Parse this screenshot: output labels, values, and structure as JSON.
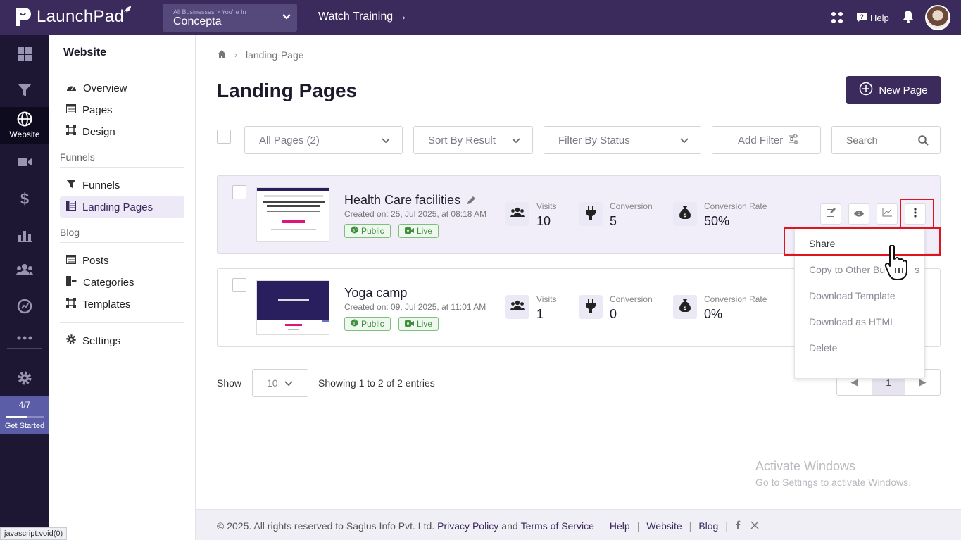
{
  "topbar": {
    "logo_text": "LaunchPad",
    "business_caption": "All Businesses > You're In",
    "business_name": "Concepta",
    "watch_training": "Watch Training →",
    "help_label": "Help"
  },
  "rail": {
    "active_label": "Website",
    "get_started_count": "4/7",
    "get_started_progress": 0.57,
    "get_started_label": "Get Started"
  },
  "sidebar": {
    "title": "Website",
    "items_website": [
      "Overview",
      "Pages",
      "Design"
    ],
    "section_funnels": "Funnels",
    "items_funnels": [
      "Funnels",
      "Landing Pages"
    ],
    "section_blog": "Blog",
    "items_blog": [
      "Posts",
      "Categories",
      "Templates"
    ],
    "settings": "Settings"
  },
  "breadcrumb": {
    "current": "landing-Page"
  },
  "page": {
    "title": "Landing Pages",
    "new_page_label": "New Page"
  },
  "filters": {
    "all_pages": "All Pages (2)",
    "sort": "Sort By Result",
    "status": "Filter By Status",
    "add_filter": "Add Filter",
    "search_placeholder": "Search"
  },
  "pages": [
    {
      "name": "Health Care facilities",
      "created": "Created on: 25, Jul 2025, at 08:18 AM",
      "visibility": "Public",
      "status": "Live",
      "visits_label": "Visits",
      "visits": "10",
      "conversion_label": "Conversion",
      "conversion": "5",
      "rate_label": "Conversion Rate",
      "rate": "50%"
    },
    {
      "name": "Yoga camp",
      "created": "Created on: 09, Jul 2025, at 11:01 AM",
      "visibility": "Public",
      "status": "Live",
      "visits_label": "Visits",
      "visits": "1",
      "conversion_label": "Conversion",
      "conversion": "0",
      "rate_label": "Conversion Rate",
      "rate": "0%"
    }
  ],
  "dropdown": {
    "items": [
      "Share",
      "Copy to Other Businesses",
      "Download Template",
      "Download as HTML",
      "Delete"
    ],
    "copy_visible": "Copy to Other Bu",
    "copy_tail": "s"
  },
  "pagination": {
    "show_label": "Show",
    "page_size": "10",
    "summary": "Showing 1 to 2 of 2 entries",
    "prev": "◀",
    "current": "1",
    "next": "▶"
  },
  "windows_watermark": {
    "line1": "Activate Windows",
    "line2": "Go to Settings to activate Windows."
  },
  "footer": {
    "copyright": "©  2025. All rights reserved to Saglus Info Pvt. Ltd.",
    "privacy": "Privacy Policy",
    "and": "and",
    "terms": "Terms of Service",
    "links": [
      "Help",
      "Website",
      "Blog"
    ]
  },
  "statusbar": {
    "text": "javascript:void(0)"
  },
  "colors": {
    "brand": "#3b2a5c",
    "rail": "#1e1733",
    "highlight": "#e0141e",
    "live_green": "#3f8f3f"
  }
}
